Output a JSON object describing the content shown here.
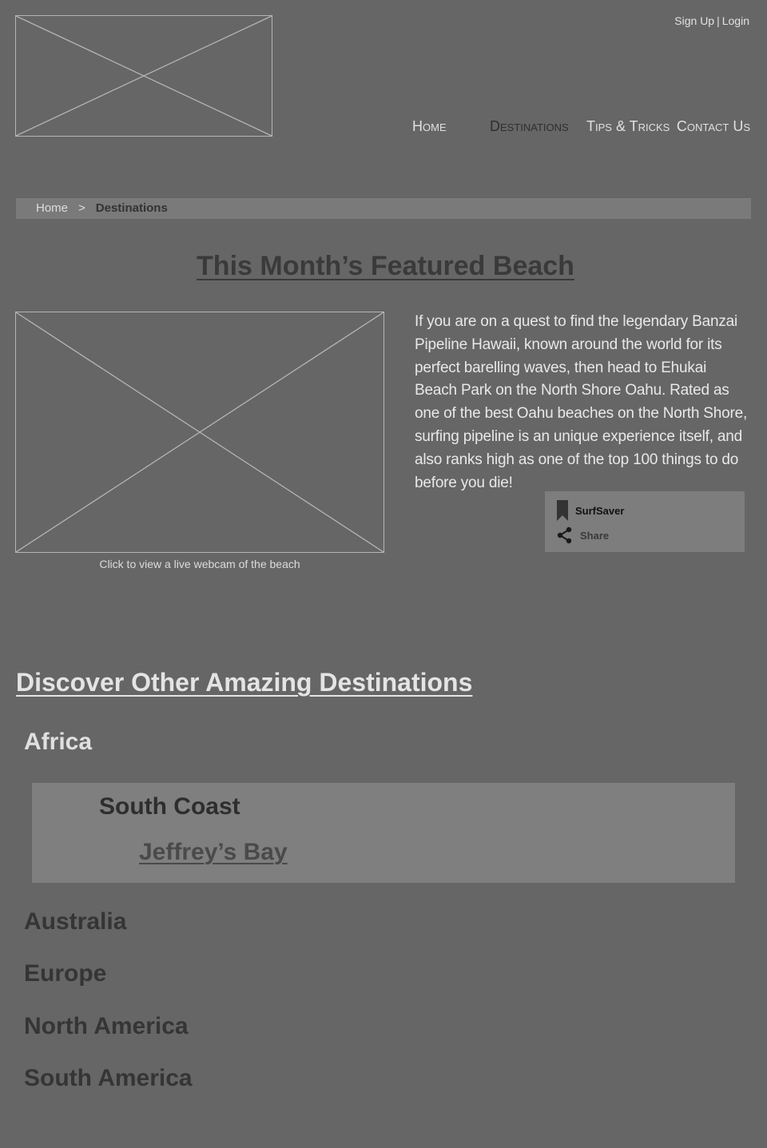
{
  "header": {
    "auth": {
      "signup": "Sign Up",
      "separator": "|",
      "login": "Login"
    },
    "nav": [
      {
        "label": "Home",
        "active": false
      },
      {
        "label": "Destinations",
        "active": true
      },
      {
        "label": "Tips & Tricks",
        "active": false
      },
      {
        "label": "Contact Us",
        "active": false
      }
    ]
  },
  "breadcrumb": {
    "home": "Home",
    "separator": ">",
    "current": "Destinations"
  },
  "featured": {
    "title": "This Month’s Featured Beach",
    "caption": "Click to view a live webcam of the beach",
    "description": "If you are on a quest to find the legendary Banzai Pipeline Hawaii, known around the world  for its perfect barelling waves, then head to Ehukai Beach Park on the North Shore Oahu.  Rated as one of the best Oahu beaches on the North Shore, surfing pipeline is an unique experience itself, and also ranks high as one of the top 100 things to do before you die!",
    "widget": {
      "save_label": "SurfSaver",
      "share_label": "Share",
      "save_icon": "bookmark-icon",
      "share_icon": "share-icon"
    }
  },
  "destinations": {
    "title": "Discover Other Amazing Destinations",
    "regions": [
      {
        "name": "Africa",
        "expanded": true,
        "subregions": [
          {
            "name": "South Coast",
            "beaches": [
              "Jeffrey’s Bay"
            ]
          }
        ]
      },
      {
        "name": "Australia",
        "expanded": false
      },
      {
        "name": "Europe",
        "expanded": false
      },
      {
        "name": "North America",
        "expanded": false
      },
      {
        "name": "South America",
        "expanded": false
      }
    ]
  },
  "colors": {
    "background": "#666666",
    "panel": "#7f7f7f",
    "placeholder_stroke": "#b5b5b5"
  }
}
